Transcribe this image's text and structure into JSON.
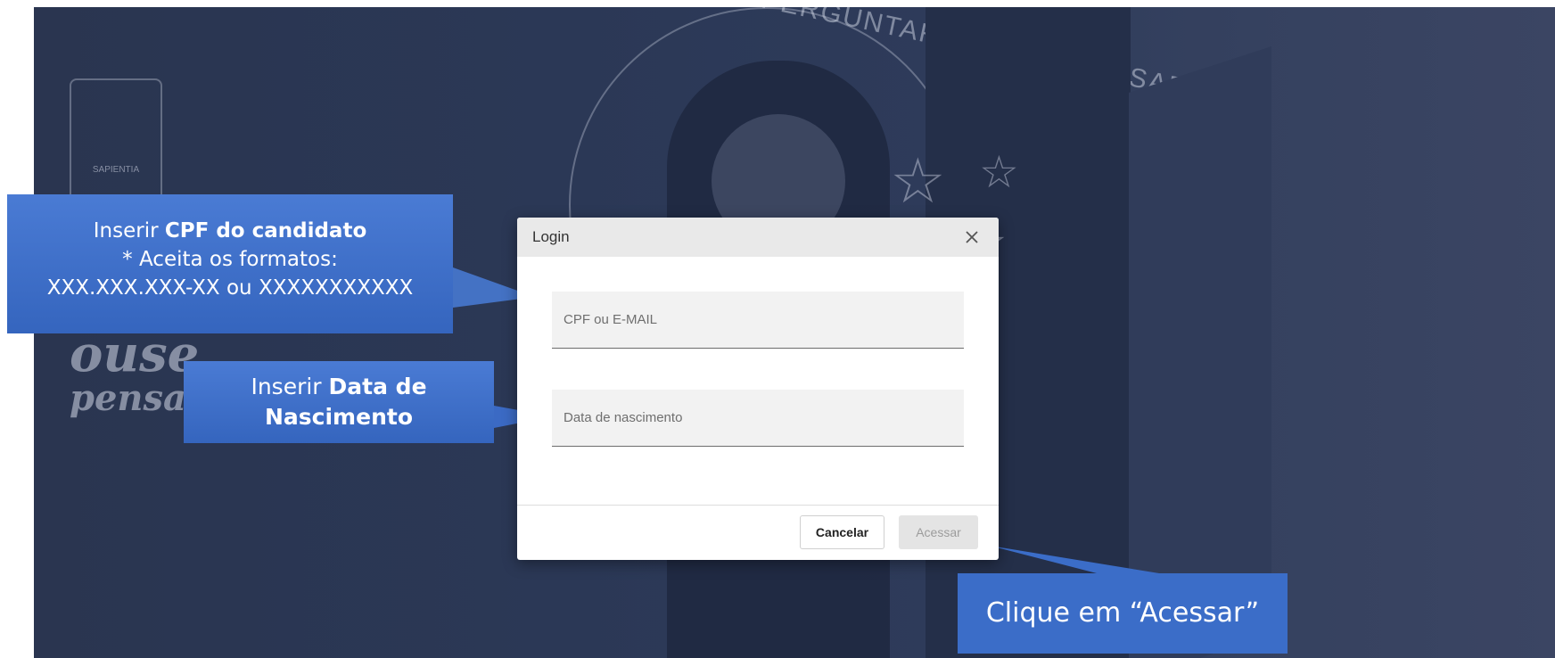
{
  "background": {
    "arc_text": "AGIR PERGUNTAR CONSTRUIR SABER",
    "crest_text": "SAPIENTIA",
    "script_line1": "ouse",
    "script_line2": "pensar"
  },
  "dialog": {
    "title": "Login",
    "cpf_placeholder": "CPF ou E-MAIL",
    "date_placeholder": "Data de nascimento",
    "cancel_label": "Cancelar",
    "submit_label": "Acessar"
  },
  "callouts": {
    "cpf": {
      "prefix": "Inserir ",
      "bold": "CPF do candidato",
      "line2": "* Aceita os formatos:",
      "line3": "XXX.XXX.XXX-XX ou XXXXXXXXXXX"
    },
    "date": {
      "prefix": "Inserir ",
      "bold1": "Data de",
      "bold2": "Nascimento"
    },
    "acessar": "Clique em “Acessar”"
  },
  "colors": {
    "callout_blue": "#3b6dc8",
    "background_navy": "#2b3856"
  },
  "icons": {
    "close": "close-icon"
  }
}
